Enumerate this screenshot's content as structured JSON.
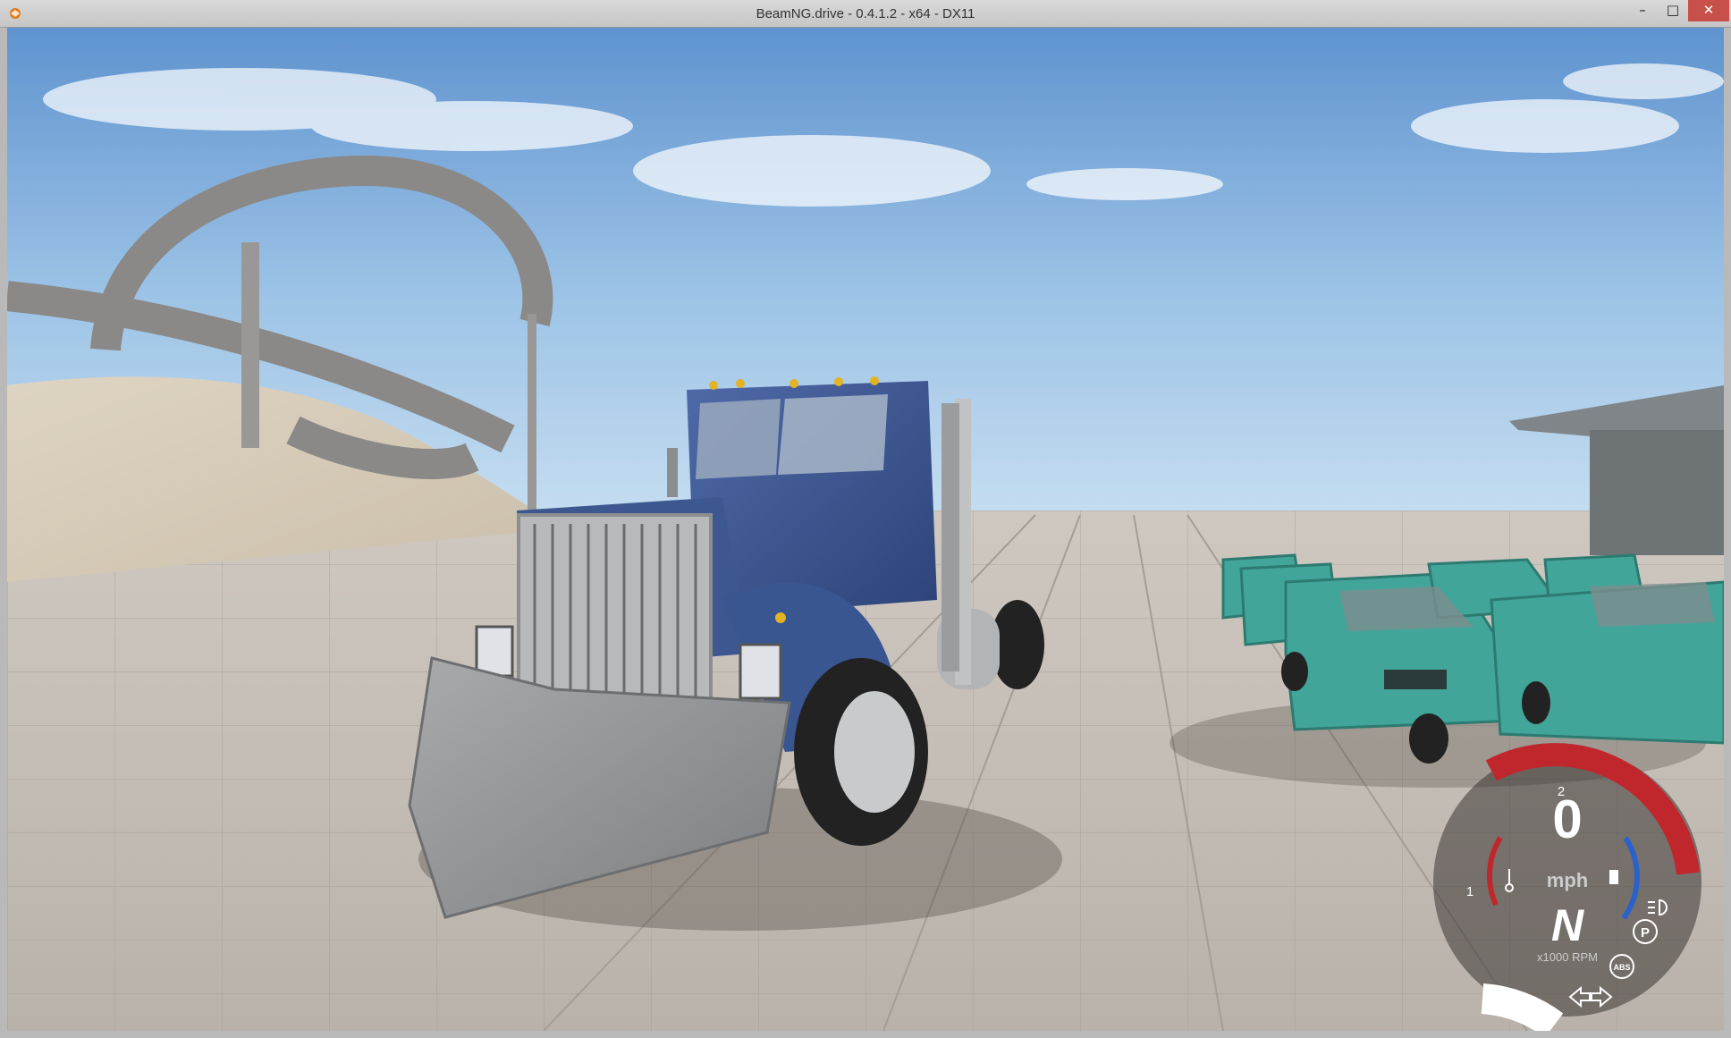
{
  "window": {
    "title": "BeamNG.drive - 0.4.1.2 - x64 - DX11",
    "minimize_glyph": "–",
    "maximize_glyph": "□",
    "close_glyph": "✕"
  },
  "hud": {
    "speed": "0",
    "speed_unit": "mph",
    "gear": "N",
    "rpm_label": "x1000 RPM",
    "rpm_tick_1": "1",
    "rpm_tick_2": "2",
    "abs_label": "ABS",
    "parking_label": "P",
    "accent_red": "#c0272d",
    "accent_blue": "#2a62c9"
  },
  "icons": [
    "beamng-logo-icon",
    "temperature-icon",
    "fuel-icon",
    "headlight-icon",
    "parking-brake-icon",
    "abs-icon",
    "left-signal-icon",
    "right-signal-icon"
  ]
}
